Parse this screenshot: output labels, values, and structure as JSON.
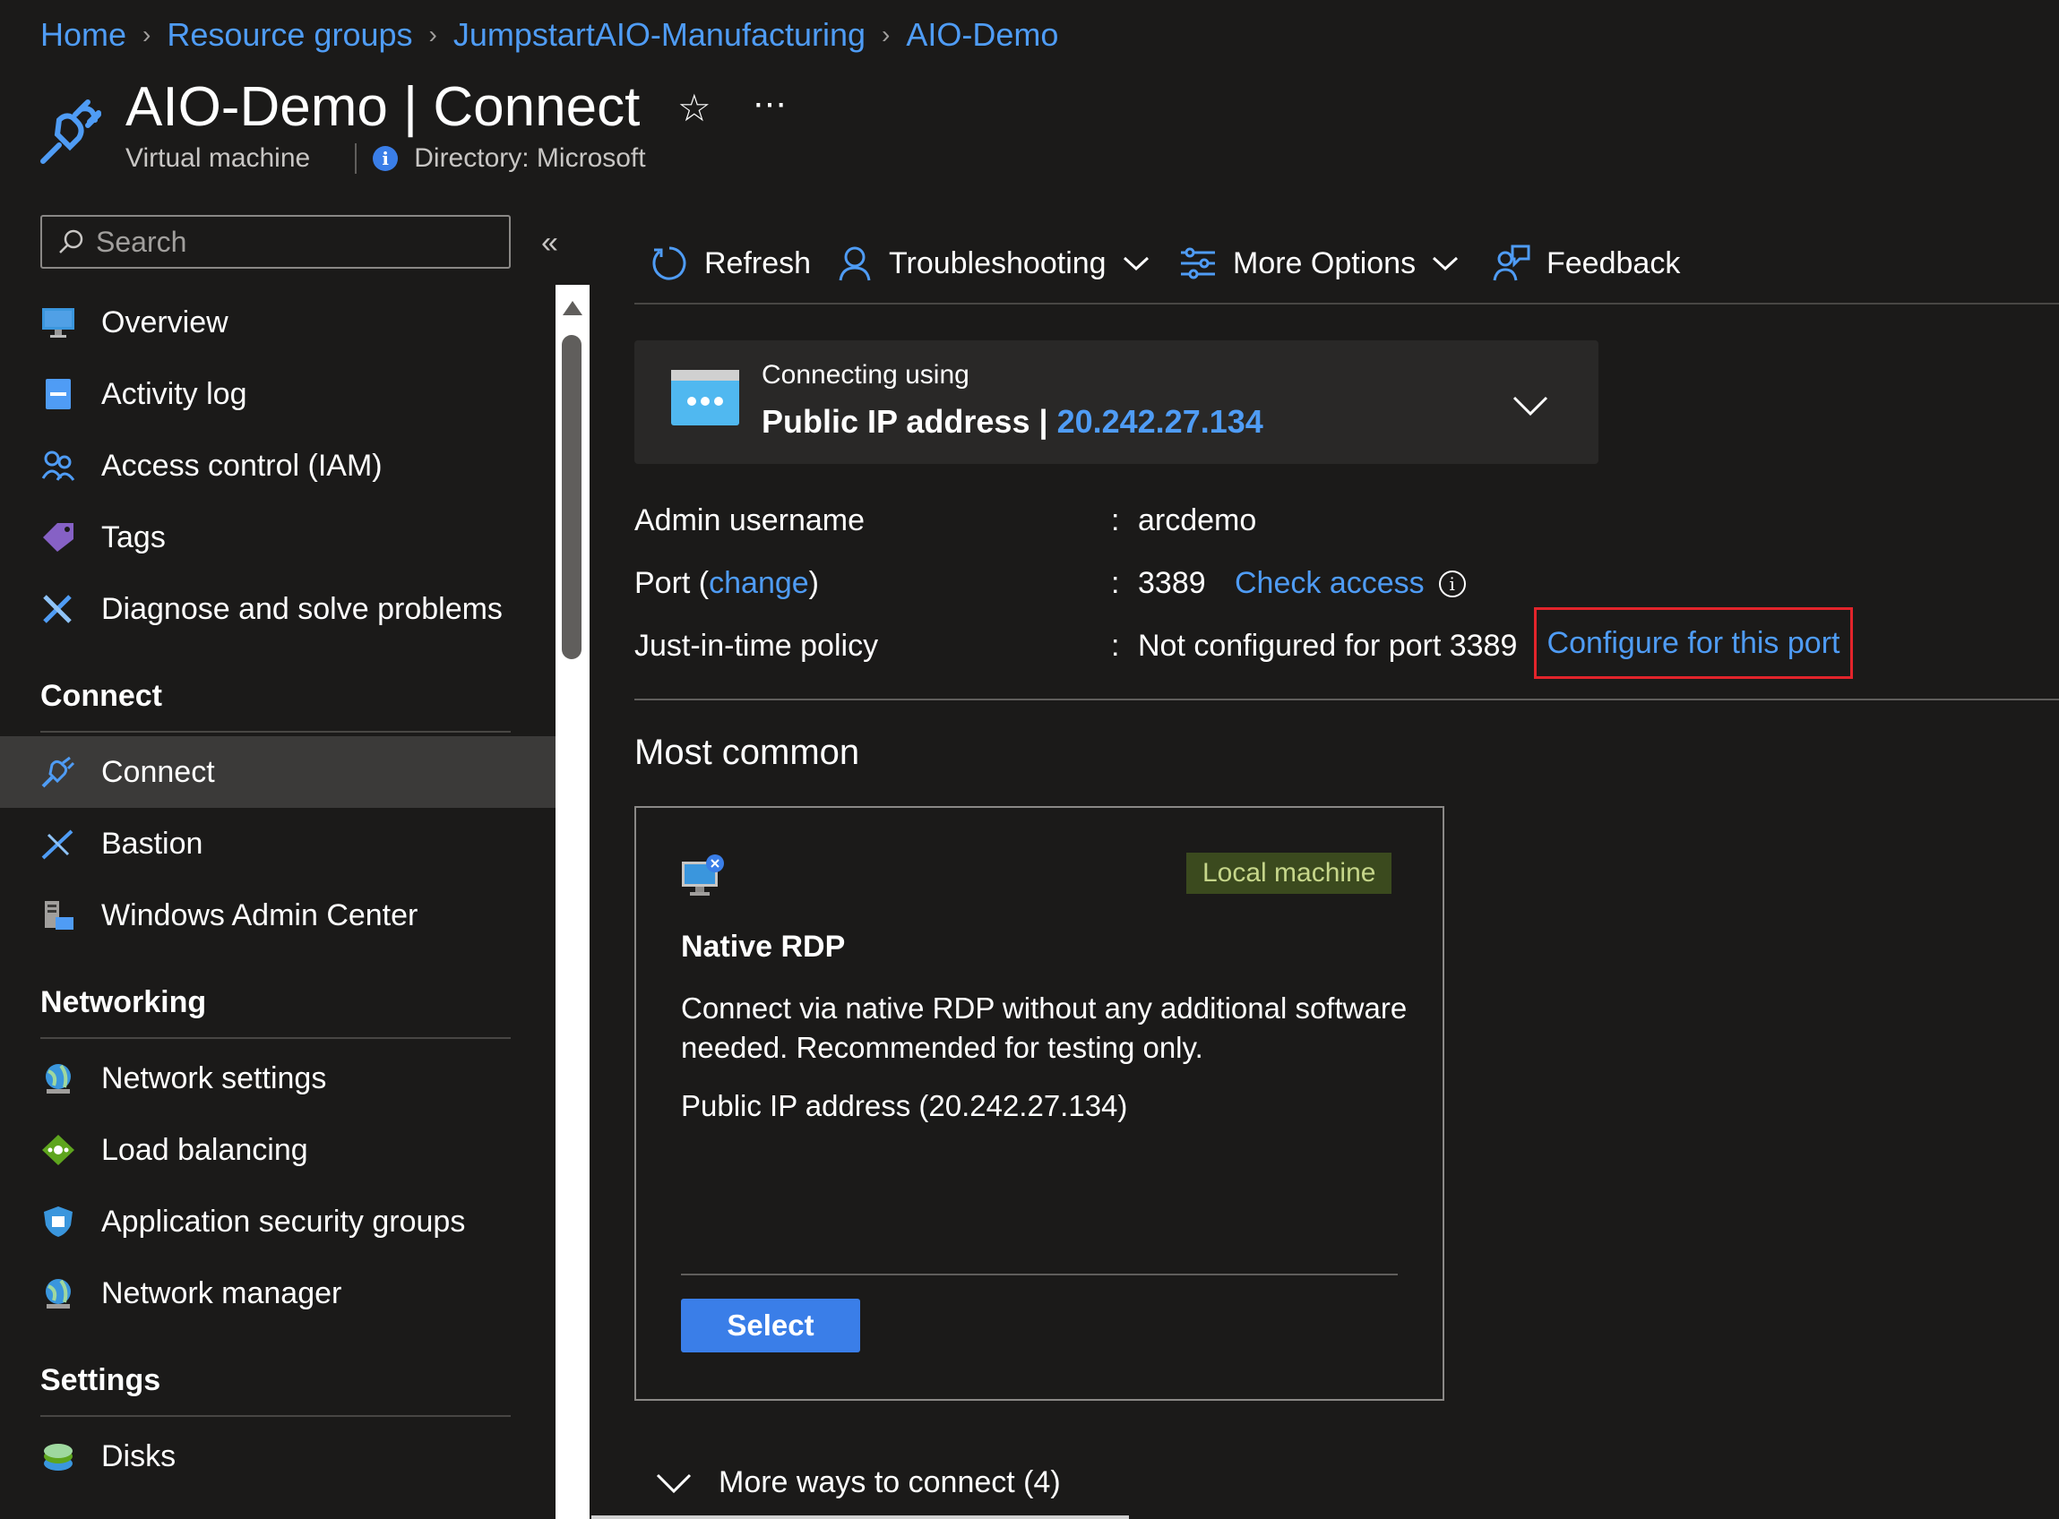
{
  "breadcrumb": [
    "Home",
    "Resource groups",
    "JumpstartAIO-Manufacturing",
    "AIO-Demo"
  ],
  "header": {
    "title": "AIO-Demo | Connect",
    "subtitle_type": "Virtual machine",
    "directory": "Directory: Microsoft"
  },
  "sidebar": {
    "search_placeholder": "Search",
    "items_top": [
      {
        "label": "Overview",
        "icon": "monitor-icon"
      },
      {
        "label": "Activity log",
        "icon": "activity-log-icon"
      },
      {
        "label": "Access control (IAM)",
        "icon": "people-icon"
      },
      {
        "label": "Tags",
        "icon": "tag-icon"
      },
      {
        "label": "Diagnose and solve problems",
        "icon": "wrench-icon"
      }
    ],
    "sections": {
      "connect": "Connect",
      "networking": "Networking",
      "settings": "Settings"
    },
    "items_connect": [
      {
        "label": "Connect",
        "icon": "plug-icon",
        "active": true
      },
      {
        "label": "Bastion",
        "icon": "bastion-icon"
      },
      {
        "label": "Windows Admin Center",
        "icon": "server-icon"
      }
    ],
    "items_networking": [
      {
        "label": "Network settings",
        "icon": "globe-icon"
      },
      {
        "label": "Load balancing",
        "icon": "load-balancer-icon"
      },
      {
        "label": "Application security groups",
        "icon": "shield-icon"
      },
      {
        "label": "Network manager",
        "icon": "globe-icon"
      }
    ],
    "items_settings": [
      {
        "label": "Disks",
        "icon": "disk-icon"
      }
    ]
  },
  "toolbar": {
    "refresh": "Refresh",
    "troubleshooting": "Troubleshooting",
    "more_options": "More Options",
    "feedback": "Feedback"
  },
  "connection": {
    "label": "Connecting using",
    "method": "Public IP address |",
    "ip": "20.242.27.134"
  },
  "properties": {
    "admin_label": "Admin username",
    "admin_value": "arcdemo",
    "port_label_prefix": "Port (",
    "port_change": "change",
    "port_label_suffix": ")",
    "port_value": "3389",
    "check_access": "Check access",
    "jit_label": "Just-in-time policy",
    "jit_value": "Not configured for port 3389",
    "configure": "Configure for this port",
    "colon": ":"
  },
  "most_common": {
    "heading": "Most common",
    "card": {
      "badge": "Local machine",
      "title": "Native RDP",
      "description": "Connect via native RDP without any additional software needed. Recommended for testing only.",
      "address": "Public IP address (20.242.27.134)",
      "select": "Select"
    }
  },
  "more_ways": "More ways to connect (4)",
  "colors": {
    "background": "#1b1a19",
    "link": "#4f9cf5",
    "primary_button": "#3a7ee8",
    "highlight_border": "#e3242b",
    "badge_bg": "#3b4a1e"
  }
}
